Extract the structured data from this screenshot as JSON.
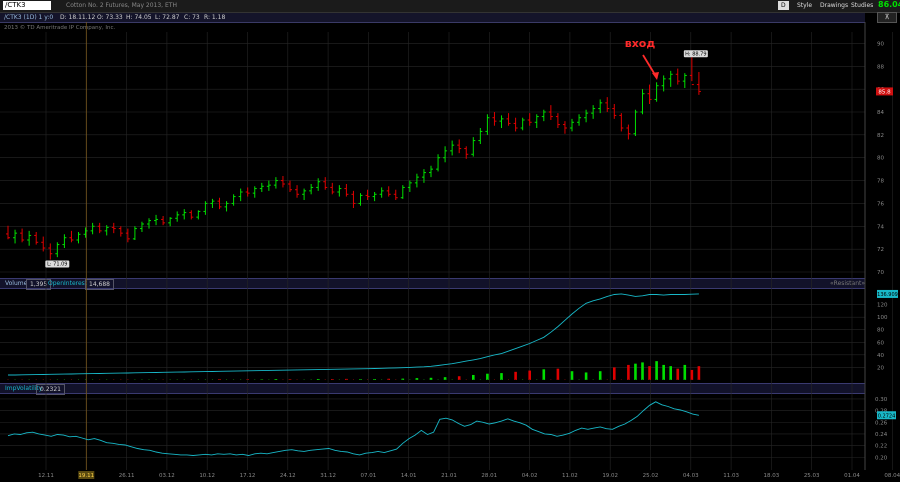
{
  "toolbar": {
    "symbol": "/CTK3",
    "description": "Cotton No. 2 Futures, May 2013, ETH",
    "d_label": "D",
    "style_label": "Style",
    "drawings_label": "Drawings",
    "studies_label": "Studies",
    "last_price": "86.04"
  },
  "quote": {
    "symbol": "/CTK3 (1D) 1 y:0",
    "date": "D: 18.11.12",
    "open": "O: 73.33",
    "high": "H: 74.05",
    "low": "L: 72.87",
    "close": "C: 73",
    "range": "R: 1.18"
  },
  "copyright": "2013 © TD Ameritrade IP Company, Inc.",
  "annotation": "вход",
  "colors": {
    "up": "#00e000",
    "down": "#e00000",
    "line": "#18b8c8",
    "grid": "#262626",
    "accent": "#ff2a2a"
  },
  "price_chart": {
    "type": "bar",
    "x_ticks": [
      "12.11",
      "19.11",
      "26.11",
      "03.12",
      "10.12",
      "17.12",
      "24.12",
      "31.12",
      "07.01",
      "14.01",
      "21.01",
      "28.01",
      "04.02",
      "11.02",
      "19.02",
      "25.02",
      "04.03",
      "11.03",
      "18.03",
      "25.03",
      "01.04",
      "08.04"
    ],
    "highlighted_x_tick": "19.11",
    "y_ticks": [
      70,
      72,
      74,
      76,
      78,
      80,
      82,
      84,
      86,
      88,
      90
    ],
    "ylim": [
      70,
      91
    ],
    "high_label": "H: 88.79",
    "low_label": "L: 71.09",
    "last_label": "85.8",
    "ohlc": [
      [
        73.33,
        74.05,
        72.87,
        73.0
      ],
      [
        73.0,
        73.7,
        72.5,
        73.4
      ],
      [
        73.4,
        73.8,
        72.6,
        72.8
      ],
      [
        72.8,
        73.6,
        72.3,
        73.2
      ],
      [
        73.2,
        73.5,
        72.4,
        72.6
      ],
      [
        72.6,
        73.1,
        71.8,
        72.1
      ],
      [
        72.1,
        72.5,
        71.09,
        71.6
      ],
      [
        71.6,
        72.6,
        71.3,
        72.4
      ],
      [
        72.4,
        73.3,
        72.1,
        73.0
      ],
      [
        73.0,
        73.6,
        72.6,
        72.8
      ],
      [
        72.8,
        73.5,
        72.5,
        73.3
      ],
      [
        73.3,
        73.9,
        73.0,
        73.6
      ],
      [
        73.6,
        74.3,
        73.3,
        74.0
      ],
      [
        74.0,
        74.3,
        73.4,
        73.6
      ],
      [
        73.6,
        74.1,
        73.2,
        73.9
      ],
      [
        73.9,
        74.3,
        73.4,
        73.8
      ],
      [
        73.8,
        74.0,
        73.1,
        73.4
      ],
      [
        73.4,
        73.8,
        72.6,
        72.9
      ],
      [
        72.9,
        74.0,
        72.8,
        73.8
      ],
      [
        73.8,
        74.4,
        73.5,
        74.2
      ],
      [
        74.2,
        74.7,
        73.8,
        74.5
      ],
      [
        74.5,
        75.0,
        74.1,
        74.6
      ],
      [
        74.6,
        74.9,
        74.1,
        74.3
      ],
      [
        74.3,
        74.8,
        74.0,
        74.7
      ],
      [
        74.7,
        75.3,
        74.4,
        75.0
      ],
      [
        75.0,
        75.5,
        74.6,
        75.2
      ],
      [
        75.2,
        75.4,
        74.6,
        74.8
      ],
      [
        74.8,
        75.4,
        74.6,
        75.3
      ],
      [
        75.3,
        76.2,
        75.0,
        76.0
      ],
      [
        76.0,
        76.4,
        75.6,
        76.2
      ],
      [
        76.2,
        76.5,
        75.5,
        75.7
      ],
      [
        75.7,
        76.2,
        75.3,
        76.0
      ],
      [
        76.0,
        76.8,
        75.8,
        76.6
      ],
      [
        76.6,
        77.3,
        76.2,
        77.0
      ],
      [
        77.0,
        77.4,
        76.6,
        76.9
      ],
      [
        76.9,
        77.5,
        76.5,
        77.3
      ],
      [
        77.3,
        77.8,
        77.0,
        77.5
      ],
      [
        77.5,
        78.0,
        77.1,
        77.6
      ],
      [
        77.6,
        78.3,
        77.3,
        78.0
      ],
      [
        78.0,
        78.4,
        77.4,
        77.7
      ],
      [
        77.7,
        78.0,
        77.0,
        77.2
      ],
      [
        77.2,
        77.6,
        76.5,
        76.8
      ],
      [
        76.8,
        77.3,
        76.3,
        77.1
      ],
      [
        77.1,
        77.7,
        76.8,
        77.4
      ],
      [
        77.4,
        78.2,
        77.1,
        77.9
      ],
      [
        77.9,
        78.3,
        77.2,
        77.4
      ],
      [
        77.4,
        77.8,
        76.8,
        77.0
      ],
      [
        77.0,
        77.6,
        76.6,
        77.3
      ],
      [
        77.3,
        77.7,
        76.6,
        76.8
      ],
      [
        76.8,
        77.1,
        75.6,
        76.0
      ],
      [
        76.0,
        76.9,
        75.8,
        76.7
      ],
      [
        76.7,
        77.2,
        76.3,
        76.6
      ],
      [
        76.6,
        77.0,
        76.2,
        76.8
      ],
      [
        76.8,
        77.4,
        76.5,
        77.1
      ],
      [
        77.1,
        77.5,
        76.6,
        76.8
      ],
      [
        76.8,
        77.2,
        76.3,
        76.5
      ],
      [
        76.5,
        77.6,
        76.4,
        77.4
      ],
      [
        77.4,
        78.0,
        77.0,
        77.8
      ],
      [
        77.8,
        78.6,
        77.4,
        78.3
      ],
      [
        78.3,
        79.0,
        77.8,
        78.7
      ],
      [
        78.7,
        79.3,
        78.3,
        79.0
      ],
      [
        79.0,
        80.3,
        78.8,
        80.0
      ],
      [
        80.0,
        81.0,
        79.6,
        80.6
      ],
      [
        80.6,
        81.5,
        80.2,
        81.1
      ],
      [
        81.1,
        81.6,
        80.4,
        80.8
      ],
      [
        80.8,
        81.0,
        79.9,
        80.3
      ],
      [
        80.3,
        81.8,
        80.1,
        81.5
      ],
      [
        81.5,
        82.6,
        81.2,
        82.3
      ],
      [
        82.3,
        83.8,
        82.0,
        83.5
      ],
      [
        83.5,
        84.0,
        82.8,
        83.2
      ],
      [
        83.2,
        83.7,
        82.6,
        83.4
      ],
      [
        83.4,
        83.9,
        82.8,
        83.0
      ],
      [
        83.0,
        83.5,
        82.3,
        82.6
      ],
      [
        82.6,
        83.5,
        82.4,
        83.3
      ],
      [
        83.3,
        83.9,
        82.8,
        83.1
      ],
      [
        83.1,
        83.8,
        82.6,
        83.6
      ],
      [
        83.6,
        84.2,
        83.2,
        84.0
      ],
      [
        84.0,
        84.6,
        83.3,
        83.6
      ],
      [
        83.6,
        83.9,
        82.6,
        82.9
      ],
      [
        82.9,
        83.2,
        82.1,
        82.6
      ],
      [
        82.6,
        83.4,
        82.3,
        83.1
      ],
      [
        83.1,
        83.8,
        82.8,
        83.5
      ],
      [
        83.5,
        84.2,
        83.1,
        83.9
      ],
      [
        83.9,
        84.6,
        83.4,
        84.3
      ],
      [
        84.3,
        85.1,
        83.9,
        84.8
      ],
      [
        84.8,
        85.3,
        84.0,
        84.3
      ],
      [
        84.3,
        84.7,
        83.4,
        83.7
      ],
      [
        83.7,
        83.9,
        82.3,
        82.6
      ],
      [
        82.6,
        82.9,
        81.6,
        82.1
      ],
      [
        82.1,
        84.2,
        81.9,
        84.0
      ],
      [
        84.0,
        86.0,
        83.8,
        85.6
      ],
      [
        85.6,
        86.4,
        84.7,
        85.1
      ],
      [
        85.1,
        86.6,
        84.9,
        86.3
      ],
      [
        86.3,
        87.2,
        85.8,
        86.9
      ],
      [
        86.9,
        87.6,
        86.2,
        87.3
      ],
      [
        87.3,
        87.8,
        86.4,
        86.7
      ],
      [
        86.7,
        87.4,
        86.1,
        87.2
      ],
      [
        87.2,
        88.79,
        86.7,
        86.4
      ],
      [
        86.4,
        87.5,
        85.5,
        85.8
      ]
    ]
  },
  "volume_panel": {
    "label": "Volume",
    "volume_value": "1,395",
    "oi_label": "OpenInterest",
    "oi_value": "14,688",
    "right_tag": "«Resistant»",
    "y_ticks": [
      20,
      40,
      60,
      80,
      100,
      120
    ],
    "ylim": [
      0,
      140
    ],
    "last_label": "136.909",
    "open_interest": [
      8,
      8,
      8.2,
      8.4,
      8.6,
      8.8,
      9,
      9.2,
      9.4,
      9.6,
      9.8,
      10,
      10.2,
      10.4,
      10.6,
      10.8,
      11,
      11.2,
      11.4,
      11.6,
      11.8,
      12,
      12.2,
      12.4,
      12.6,
      12.8,
      13,
      13.2,
      13.4,
      13.6,
      13.8,
      14,
      14.2,
      14.4,
      14.6,
      14.8,
      15,
      15.2,
      15.4,
      15.6,
      15.8,
      16,
      16.2,
      16.4,
      16.6,
      16.8,
      17,
      17.2,
      17.4,
      17.6,
      17.8,
      18,
      18.3,
      18.6,
      18.9,
      19.2,
      19.6,
      20,
      20.5,
      21,
      21.8,
      23,
      24.5,
      26,
      28,
      30,
      32,
      34,
      37,
      40,
      42,
      46,
      50,
      54,
      58,
      63,
      68,
      76,
      85,
      95,
      105,
      114,
      122,
      126,
      129,
      133,
      136,
      137,
      135,
      133,
      134,
      136,
      136,
      135,
      136,
      136,
      136,
      136.5,
      136.9
    ],
    "volume": [
      1,
      1,
      1,
      1,
      1,
      1,
      1,
      1,
      1,
      1,
      1,
      1,
      1,
      1,
      1,
      1,
      1,
      1,
      1,
      1,
      1,
      1,
      1,
      1,
      1,
      1,
      1,
      1,
      1,
      1,
      1,
      1,
      1,
      1,
      1,
      1,
      1,
      1,
      1,
      1,
      1,
      1,
      1,
      1,
      1,
      1,
      1,
      1,
      1,
      1,
      1,
      1,
      1,
      1,
      1,
      1,
      1,
      1,
      1,
      1,
      1,
      1,
      1,
      1,
      1,
      1,
      1,
      1,
      1,
      1,
      1,
      1,
      1,
      1,
      1,
      1,
      1,
      1,
      1,
      1,
      1,
      1,
      1,
      1,
      1,
      1,
      1,
      1,
      1,
      1,
      1,
      1,
      1,
      1,
      1,
      1,
      1,
      1,
      1
    ],
    "volume_bars": [
      {
        "i": 30,
        "v": 1.2
      },
      {
        "i": 34,
        "v": 1.0
      },
      {
        "i": 36,
        "v": 0.8
      },
      {
        "i": 38,
        "v": 1.5
      },
      {
        "i": 40,
        "v": 1.1
      },
      {
        "i": 44,
        "v": 1.6
      },
      {
        "i": 46,
        "v": 1.4
      },
      {
        "i": 48,
        "v": 1.8
      },
      {
        "i": 50,
        "v": 1.2
      },
      {
        "i": 52,
        "v": 1.5
      },
      {
        "i": 54,
        "v": 2.0
      },
      {
        "i": 56,
        "v": 2.2
      },
      {
        "i": 58,
        "v": 3.0
      },
      {
        "i": 60,
        "v": 3.5
      },
      {
        "i": 62,
        "v": 4.5
      },
      {
        "i": 64,
        "v": 6
      },
      {
        "i": 66,
        "v": 8
      },
      {
        "i": 68,
        "v": 10
      },
      {
        "i": 70,
        "v": 11
      },
      {
        "i": 72,
        "v": 13
      },
      {
        "i": 74,
        "v": 15
      },
      {
        "i": 76,
        "v": 17
      },
      {
        "i": 78,
        "v": 18
      },
      {
        "i": 80,
        "v": 14
      },
      {
        "i": 82,
        "v": 12
      },
      {
        "i": 84,
        "v": 14
      },
      {
        "i": 86,
        "v": 20
      },
      {
        "i": 88,
        "v": 24
      },
      {
        "i": 89,
        "v": 26
      },
      {
        "i": 90,
        "v": 28
      },
      {
        "i": 91,
        "v": 22
      },
      {
        "i": 92,
        "v": 30
      },
      {
        "i": 93,
        "v": 24
      },
      {
        "i": 94,
        "v": 22
      },
      {
        "i": 95,
        "v": 18
      },
      {
        "i": 96,
        "v": 24
      },
      {
        "i": 97,
        "v": 16
      },
      {
        "i": 98,
        "v": 22
      }
    ]
  },
  "iv_panel": {
    "label": "ImpVolatility",
    "value": "0.2321",
    "y_ticks": [
      0.2,
      0.22,
      0.24,
      0.26,
      0.28,
      0.3
    ],
    "ylim": [
      0.185,
      0.305
    ],
    "last_label": "0.2724",
    "values": [
      0.237,
      0.24,
      0.239,
      0.242,
      0.243,
      0.24,
      0.238,
      0.236,
      0.239,
      0.238,
      0.235,
      0.236,
      0.233,
      0.23,
      0.232,
      0.229,
      0.225,
      0.224,
      0.222,
      0.221,
      0.218,
      0.215,
      0.213,
      0.212,
      0.209,
      0.207,
      0.206,
      0.205,
      0.204,
      0.204,
      0.203,
      0.204,
      0.205,
      0.204,
      0.206,
      0.205,
      0.206,
      0.204,
      0.205,
      0.203,
      0.206,
      0.207,
      0.206,
      0.208,
      0.21,
      0.212,
      0.213,
      0.211,
      0.21,
      0.212,
      0.213,
      0.214,
      0.215,
      0.212,
      0.21,
      0.209,
      0.206,
      0.204,
      0.207,
      0.208,
      0.21,
      0.208,
      0.211,
      0.214,
      0.224,
      0.232,
      0.238,
      0.246,
      0.239,
      0.243,
      0.265,
      0.267,
      0.264,
      0.258,
      0.253,
      0.256,
      0.262,
      0.26,
      0.257,
      0.259,
      0.262,
      0.266,
      0.262,
      0.259,
      0.255,
      0.248,
      0.244,
      0.24,
      0.239,
      0.236,
      0.238,
      0.241,
      0.246,
      0.25,
      0.248,
      0.25,
      0.252,
      0.249,
      0.248,
      0.253,
      0.257,
      0.263,
      0.27,
      0.28,
      0.289,
      0.295,
      0.29,
      0.287,
      0.283,
      0.281,
      0.278,
      0.274,
      0.272
    ]
  }
}
